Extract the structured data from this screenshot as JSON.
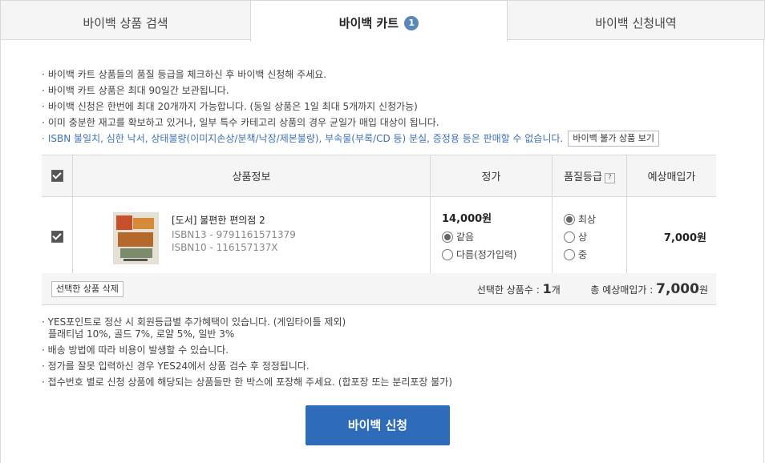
{
  "tabs": [
    {
      "label": "바이백 상품 검색"
    },
    {
      "label": "바이백 카트",
      "badge": "1"
    },
    {
      "label": "바이백 신청내역"
    }
  ],
  "notices": [
    "바이백 카트 상품들의 품질 등급을 체크하신 후 바이백 신청해 주세요.",
    "바이백 카트 상품은 최대 90일간 보관됩니다.",
    "바이백 신청은 한번에 최대 20개까지 가능합니다. (동일 상품은 1일 최대 5개까지 신청가능)",
    "이미 충분한 재고를 확보하고 있거나, 일부 특수 카테고리 상품의 경우 균일가 매입 대상이 됩니다.",
    "ISBN 불일치, 심한 낙서, 상태불량(이미지손상/분책/낙장/제본불량), 부속물(부록/CD 등) 분실, 증정용 등은 판매할 수 없습니다."
  ],
  "notice_button": "바이백 불가 상품 보기",
  "table": {
    "headers": {
      "info": "상품정보",
      "price": "정가",
      "grade": "품질등급",
      "grade_help": "?",
      "estimate": "예상매입가"
    },
    "rows": [
      {
        "checked": true,
        "title": "[도서] 불편한 편의점 2",
        "isbn13": "ISBN13 - 9791161571379",
        "isbn10": "ISBN10 - 116157137X",
        "price": "14,000원",
        "price_options": [
          "같음",
          "다름(정가입력)"
        ],
        "price_selected": "같음",
        "grades": [
          "최상",
          "상",
          "중"
        ],
        "grade_selected": "최상",
        "estimate": "7,000원"
      }
    ]
  },
  "summary": {
    "delete_button": "선택한 상품 삭제",
    "count_label": "선택한 상품수 :",
    "count_value": "1",
    "count_unit": "개",
    "total_label": "총 예상매입가 :",
    "total_value": "7,000",
    "total_unit": "원"
  },
  "notes": [
    "YES포인트로 정산 시 회원등급별 추가혜택이 있습니다. (게임타이틀 제외)",
    "플래티넘 10%, 골드 7%, 로얄 5%, 일반 3%",
    "배송 방법에 따라 비용이 발생할 수 있습니다.",
    "정가를 잘못 입력하신 경우 YES24에서 상품 검수 후 정정됩니다.",
    "접수번호 별로 신청 상품에 해당되는 상품들만 한 박스에 포장해 주세요. (합포장 또는 분리포장 불가)"
  ],
  "submit_button": "바이백 신청",
  "colors": {
    "accent": "#2e6bb8",
    "badge": "#5b86b8",
    "notice_blue": "#3f72b5"
  }
}
